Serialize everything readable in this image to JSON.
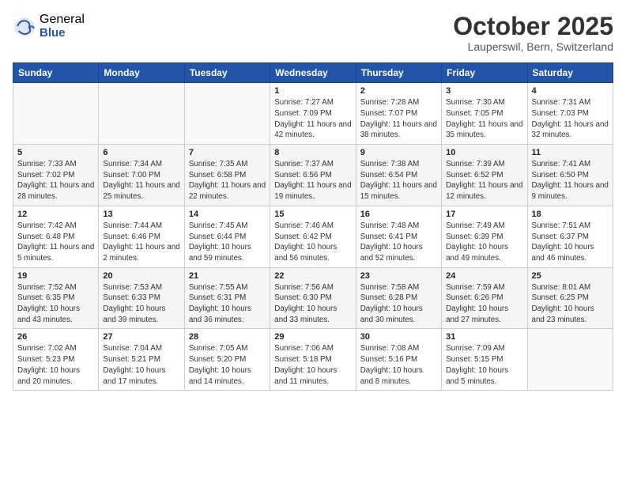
{
  "header": {
    "logo_general": "General",
    "logo_blue": "Blue",
    "month_title": "October 2025",
    "location": "Lauperswil, Bern, Switzerland"
  },
  "weekdays": [
    "Sunday",
    "Monday",
    "Tuesday",
    "Wednesday",
    "Thursday",
    "Friday",
    "Saturday"
  ],
  "weeks": [
    [
      {
        "day": "",
        "sunrise": "",
        "sunset": "",
        "daylight": ""
      },
      {
        "day": "",
        "sunrise": "",
        "sunset": "",
        "daylight": ""
      },
      {
        "day": "",
        "sunrise": "",
        "sunset": "",
        "daylight": ""
      },
      {
        "day": "1",
        "sunrise": "Sunrise: 7:27 AM",
        "sunset": "Sunset: 7:09 PM",
        "daylight": "Daylight: 11 hours and 42 minutes."
      },
      {
        "day": "2",
        "sunrise": "Sunrise: 7:28 AM",
        "sunset": "Sunset: 7:07 PM",
        "daylight": "Daylight: 11 hours and 38 minutes."
      },
      {
        "day": "3",
        "sunrise": "Sunrise: 7:30 AM",
        "sunset": "Sunset: 7:05 PM",
        "daylight": "Daylight: 11 hours and 35 minutes."
      },
      {
        "day": "4",
        "sunrise": "Sunrise: 7:31 AM",
        "sunset": "Sunset: 7:03 PM",
        "daylight": "Daylight: 11 hours and 32 minutes."
      }
    ],
    [
      {
        "day": "5",
        "sunrise": "Sunrise: 7:33 AM",
        "sunset": "Sunset: 7:02 PM",
        "daylight": "Daylight: 11 hours and 28 minutes."
      },
      {
        "day": "6",
        "sunrise": "Sunrise: 7:34 AM",
        "sunset": "Sunset: 7:00 PM",
        "daylight": "Daylight: 11 hours and 25 minutes."
      },
      {
        "day": "7",
        "sunrise": "Sunrise: 7:35 AM",
        "sunset": "Sunset: 6:58 PM",
        "daylight": "Daylight: 11 hours and 22 minutes."
      },
      {
        "day": "8",
        "sunrise": "Sunrise: 7:37 AM",
        "sunset": "Sunset: 6:56 PM",
        "daylight": "Daylight: 11 hours and 19 minutes."
      },
      {
        "day": "9",
        "sunrise": "Sunrise: 7:38 AM",
        "sunset": "Sunset: 6:54 PM",
        "daylight": "Daylight: 11 hours and 15 minutes."
      },
      {
        "day": "10",
        "sunrise": "Sunrise: 7:39 AM",
        "sunset": "Sunset: 6:52 PM",
        "daylight": "Daylight: 11 hours and 12 minutes."
      },
      {
        "day": "11",
        "sunrise": "Sunrise: 7:41 AM",
        "sunset": "Sunset: 6:50 PM",
        "daylight": "Daylight: 11 hours and 9 minutes."
      }
    ],
    [
      {
        "day": "12",
        "sunrise": "Sunrise: 7:42 AM",
        "sunset": "Sunset: 6:48 PM",
        "daylight": "Daylight: 11 hours and 5 minutes."
      },
      {
        "day": "13",
        "sunrise": "Sunrise: 7:44 AM",
        "sunset": "Sunset: 6:46 PM",
        "daylight": "Daylight: 11 hours and 2 minutes."
      },
      {
        "day": "14",
        "sunrise": "Sunrise: 7:45 AM",
        "sunset": "Sunset: 6:44 PM",
        "daylight": "Daylight: 10 hours and 59 minutes."
      },
      {
        "day": "15",
        "sunrise": "Sunrise: 7:46 AM",
        "sunset": "Sunset: 6:42 PM",
        "daylight": "Daylight: 10 hours and 56 minutes."
      },
      {
        "day": "16",
        "sunrise": "Sunrise: 7:48 AM",
        "sunset": "Sunset: 6:41 PM",
        "daylight": "Daylight: 10 hours and 52 minutes."
      },
      {
        "day": "17",
        "sunrise": "Sunrise: 7:49 AM",
        "sunset": "Sunset: 6:39 PM",
        "daylight": "Daylight: 10 hours and 49 minutes."
      },
      {
        "day": "18",
        "sunrise": "Sunrise: 7:51 AM",
        "sunset": "Sunset: 6:37 PM",
        "daylight": "Daylight: 10 hours and 46 minutes."
      }
    ],
    [
      {
        "day": "19",
        "sunrise": "Sunrise: 7:52 AM",
        "sunset": "Sunset: 6:35 PM",
        "daylight": "Daylight: 10 hours and 43 minutes."
      },
      {
        "day": "20",
        "sunrise": "Sunrise: 7:53 AM",
        "sunset": "Sunset: 6:33 PM",
        "daylight": "Daylight: 10 hours and 39 minutes."
      },
      {
        "day": "21",
        "sunrise": "Sunrise: 7:55 AM",
        "sunset": "Sunset: 6:31 PM",
        "daylight": "Daylight: 10 hours and 36 minutes."
      },
      {
        "day": "22",
        "sunrise": "Sunrise: 7:56 AM",
        "sunset": "Sunset: 6:30 PM",
        "daylight": "Daylight: 10 hours and 33 minutes."
      },
      {
        "day": "23",
        "sunrise": "Sunrise: 7:58 AM",
        "sunset": "Sunset: 6:28 PM",
        "daylight": "Daylight: 10 hours and 30 minutes."
      },
      {
        "day": "24",
        "sunrise": "Sunrise: 7:59 AM",
        "sunset": "Sunset: 6:26 PM",
        "daylight": "Daylight: 10 hours and 27 minutes."
      },
      {
        "day": "25",
        "sunrise": "Sunrise: 8:01 AM",
        "sunset": "Sunset: 6:25 PM",
        "daylight": "Daylight: 10 hours and 23 minutes."
      }
    ],
    [
      {
        "day": "26",
        "sunrise": "Sunrise: 7:02 AM",
        "sunset": "Sunset: 5:23 PM",
        "daylight": "Daylight: 10 hours and 20 minutes."
      },
      {
        "day": "27",
        "sunrise": "Sunrise: 7:04 AM",
        "sunset": "Sunset: 5:21 PM",
        "daylight": "Daylight: 10 hours and 17 minutes."
      },
      {
        "day": "28",
        "sunrise": "Sunrise: 7:05 AM",
        "sunset": "Sunset: 5:20 PM",
        "daylight": "Daylight: 10 hours and 14 minutes."
      },
      {
        "day": "29",
        "sunrise": "Sunrise: 7:06 AM",
        "sunset": "Sunset: 5:18 PM",
        "daylight": "Daylight: 10 hours and 11 minutes."
      },
      {
        "day": "30",
        "sunrise": "Sunrise: 7:08 AM",
        "sunset": "Sunset: 5:16 PM",
        "daylight": "Daylight: 10 hours and 8 minutes."
      },
      {
        "day": "31",
        "sunrise": "Sunrise: 7:09 AM",
        "sunset": "Sunset: 5:15 PM",
        "daylight": "Daylight: 10 hours and 5 minutes."
      },
      {
        "day": "",
        "sunrise": "",
        "sunset": "",
        "daylight": ""
      }
    ]
  ]
}
